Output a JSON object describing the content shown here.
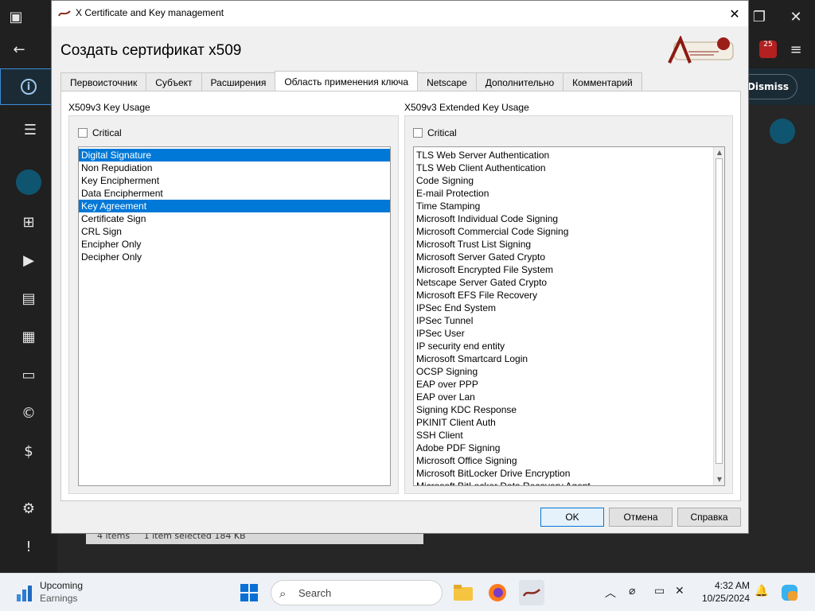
{
  "background": {
    "dismiss_label": "Dismiss",
    "badge_count": "25",
    "explorer_status": {
      "items": "4 items",
      "selected": "1 item selected 184 KB"
    }
  },
  "dialog": {
    "window_title": "X Certificate and Key management",
    "heading": "Создать сертификат x509",
    "tabs": [
      {
        "label": "Первоисточник"
      },
      {
        "label": "Субъект"
      },
      {
        "label": "Расширения"
      },
      {
        "label": "Область применения ключа"
      },
      {
        "label": "Netscape"
      },
      {
        "label": "Дополнительно"
      },
      {
        "label": "Комментарий"
      }
    ],
    "active_tab": "Область применения ключа",
    "key_usage": {
      "title": "X509v3 Key Usage",
      "critical_label": "Critical",
      "critical_checked": false,
      "items": [
        {
          "label": "Digital Signature",
          "selected": true
        },
        {
          "label": "Non Repudiation",
          "selected": false
        },
        {
          "label": "Key Encipherment",
          "selected": false
        },
        {
          "label": "Data Encipherment",
          "selected": false
        },
        {
          "label": "Key Agreement",
          "selected": true
        },
        {
          "label": "Certificate Sign",
          "selected": false
        },
        {
          "label": "CRL Sign",
          "selected": false
        },
        {
          "label": "Encipher Only",
          "selected": false
        },
        {
          "label": "Decipher Only",
          "selected": false
        }
      ]
    },
    "extended_key_usage": {
      "title": "X509v3 Extended Key Usage",
      "critical_label": "Critical",
      "critical_checked": false,
      "items": [
        "TLS Web Server Authentication",
        "TLS Web Client Authentication",
        "Code Signing",
        "E-mail Protection",
        "Time Stamping",
        "Microsoft Individual Code Signing",
        "Microsoft Commercial Code Signing",
        "Microsoft Trust List Signing",
        "Microsoft Server Gated Crypto",
        "Microsoft Encrypted File System",
        "Netscape Server Gated Crypto",
        "Microsoft EFS File Recovery",
        "IPSec End System",
        "IPSec Tunnel",
        "IPSec User",
        "IP security end entity",
        "Microsoft Smartcard Login",
        "OCSP Signing",
        "EAP over PPP",
        "EAP over Lan",
        "Signing KDC Response",
        "PKINIT Client Auth",
        "SSH Client",
        "Adobe PDF Signing",
        "Microsoft Office Signing",
        "Microsoft BitLocker Drive Encryption",
        "Microsoft BitLocker Data Recovery Agent"
      ]
    },
    "buttons": {
      "ok": "OK",
      "cancel": "Отмена",
      "help": "Справка"
    }
  },
  "taskbar": {
    "widget_title": "Upcoming",
    "widget_subtitle": "Earnings",
    "search_placeholder": "Search",
    "time": "4:32 AM",
    "date": "10/25/2024"
  },
  "colors": {
    "selection": "#0078d7",
    "dialog_bg": "#f0f0f0",
    "background_app": "#202020"
  }
}
